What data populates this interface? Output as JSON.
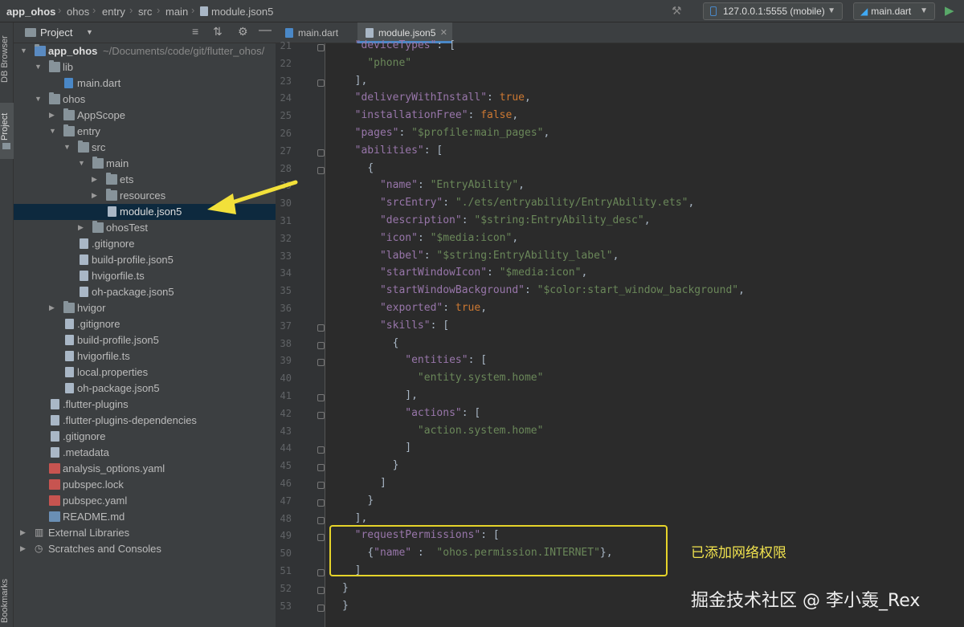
{
  "breadcrumb": [
    "app_ohos",
    "ohos",
    "entry",
    "src",
    "main",
    "module.json5"
  ],
  "toolbar": {
    "device": "127.0.0.1:5555 (mobile)",
    "run_config": "main.dart"
  },
  "side_tabs": {
    "db_browser": "DB Browser",
    "project": "Project",
    "bookmarks": "Bookmarks"
  },
  "project_panel": {
    "title": "Project",
    "root_name": "app_ohos",
    "root_path": "~/Documents/code/git/flutter_ohos/",
    "items": [
      {
        "label": "lib"
      },
      {
        "label": "main.dart"
      },
      {
        "label": "ohos"
      },
      {
        "label": "AppScope"
      },
      {
        "label": "entry"
      },
      {
        "label": "src"
      },
      {
        "label": "main"
      },
      {
        "label": "ets"
      },
      {
        "label": "resources"
      },
      {
        "label": "module.json5"
      },
      {
        "label": "ohosTest"
      },
      {
        "label": ".gitignore"
      },
      {
        "label": "build-profile.json5"
      },
      {
        "label": "hvigorfile.ts"
      },
      {
        "label": "oh-package.json5"
      },
      {
        "label": "hvigor"
      },
      {
        "label": ".gitignore"
      },
      {
        "label": "build-profile.json5"
      },
      {
        "label": "hvigorfile.ts"
      },
      {
        "label": "local.properties"
      },
      {
        "label": "oh-package.json5"
      },
      {
        "label": ".flutter-plugins"
      },
      {
        "label": ".flutter-plugins-dependencies"
      },
      {
        "label": ".gitignore"
      },
      {
        "label": ".metadata"
      },
      {
        "label": "analysis_options.yaml"
      },
      {
        "label": "pubspec.lock"
      },
      {
        "label": "pubspec.yaml"
      },
      {
        "label": "README.md"
      },
      {
        "label": "External Libraries"
      },
      {
        "label": "Scratches and Consoles"
      }
    ]
  },
  "editor_tabs": [
    {
      "label": "main.dart",
      "active": false
    },
    {
      "label": "module.json5",
      "active": true
    }
  ],
  "code_lines": [
    {
      "n": "21",
      "t": "  \"deviceTypes\": ["
    },
    {
      "n": "22",
      "t": "    \"phone\""
    },
    {
      "n": "23",
      "t": "  ],"
    },
    {
      "n": "24",
      "t": "  \"deliveryWithInstall\": true,"
    },
    {
      "n": "25",
      "t": "  \"installationFree\": false,"
    },
    {
      "n": "26",
      "t": "  \"pages\": \"$profile:main_pages\","
    },
    {
      "n": "27",
      "t": "  \"abilities\": ["
    },
    {
      "n": "28",
      "t": "    {"
    },
    {
      "n": "29",
      "t": "      \"name\": \"EntryAbility\","
    },
    {
      "n": "30",
      "t": "      \"srcEntry\": \"./ets/entryability/EntryAbility.ets\","
    },
    {
      "n": "31",
      "t": "      \"description\": \"$string:EntryAbility_desc\","
    },
    {
      "n": "32",
      "t": "      \"icon\": \"$media:icon\","
    },
    {
      "n": "33",
      "t": "      \"label\": \"$string:EntryAbility_label\","
    },
    {
      "n": "34",
      "t": "      \"startWindowIcon\": \"$media:icon\","
    },
    {
      "n": "35",
      "t": "      \"startWindowBackground\": \"$color:start_window_background\","
    },
    {
      "n": "36",
      "t": "      \"exported\": true,"
    },
    {
      "n": "37",
      "t": "      \"skills\": ["
    },
    {
      "n": "38",
      "t": "        {"
    },
    {
      "n": "39",
      "t": "          \"entities\": ["
    },
    {
      "n": "40",
      "t": "            \"entity.system.home\""
    },
    {
      "n": "41",
      "t": "          ],"
    },
    {
      "n": "42",
      "t": "          \"actions\": ["
    },
    {
      "n": "43",
      "t": "            \"action.system.home\""
    },
    {
      "n": "44",
      "t": "          ]"
    },
    {
      "n": "45",
      "t": "        }"
    },
    {
      "n": "46",
      "t": "      ]"
    },
    {
      "n": "47",
      "t": "    }"
    },
    {
      "n": "48",
      "t": "  ],"
    },
    {
      "n": "49",
      "t": "  \"requestPermissions\": ["
    },
    {
      "n": "50",
      "t": "    {\"name\" :  \"ohos.permission.INTERNET\"},"
    },
    {
      "n": "51",
      "t": "  ]"
    },
    {
      "n": "52",
      "t": "}"
    },
    {
      "n": "53",
      "t": "}"
    }
  ],
  "annotation": "已添加网络权限",
  "watermark": "掘金技术社区 @ 李小轰_Rex",
  "colors": {
    "highlight_box": "#e6d42a",
    "arrow": "#f2e03a",
    "annotation_text": "#f0e24e"
  }
}
